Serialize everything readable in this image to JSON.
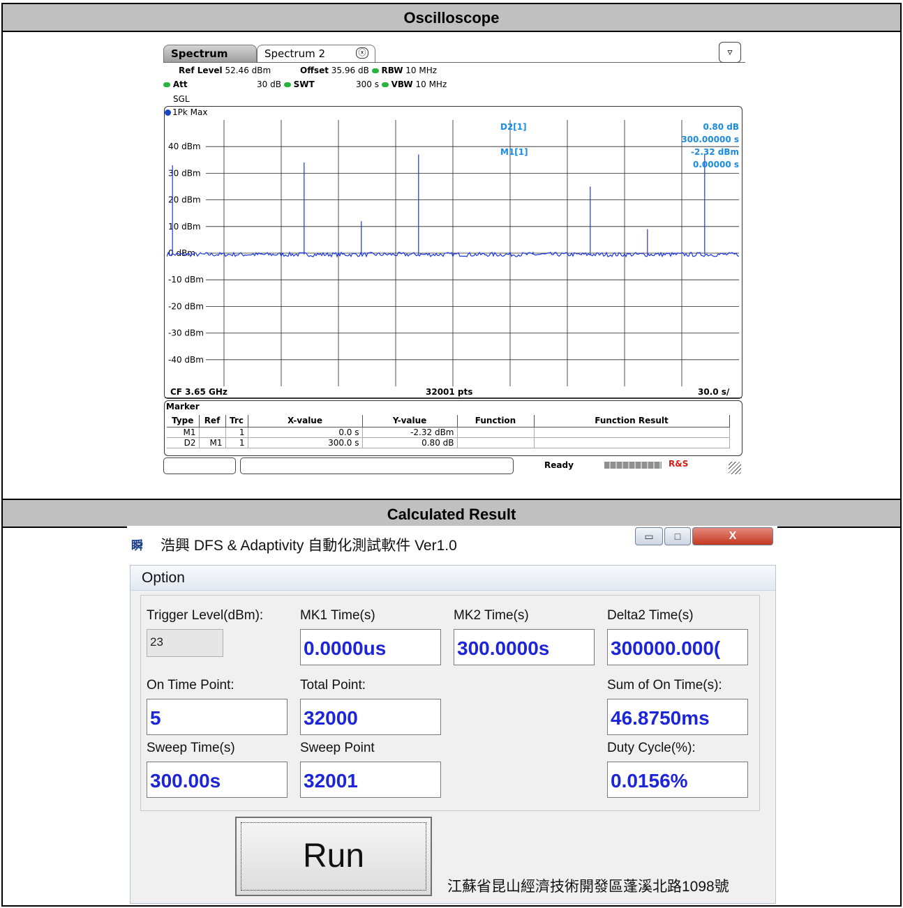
{
  "sections": {
    "top_header": "Oscilloscope",
    "bottom_header": "Calculated Result"
  },
  "analyzer": {
    "tabs": [
      {
        "label": "Spectrum"
      },
      {
        "label": "Spectrum 2"
      }
    ],
    "tab_close": "ⓧ",
    "params": {
      "ref_level_label": "Ref Level",
      "ref_level_value": "52.46 dBm",
      "offset_label": "Offset",
      "offset_value": "35.96 dB",
      "rbw_label": "RBW",
      "rbw_value": "10 MHz",
      "att_label": "Att",
      "att_value": "30 dB",
      "swt_label": "SWT",
      "swt_value": "300 s",
      "vbw_label": "VBW",
      "vbw_value": "10 MHz",
      "sgl": "SGL"
    },
    "trace_label": "1Pk Max",
    "y_ticks": [
      "40 dBm",
      "30 dBm",
      "20 dBm",
      "10 dBm",
      "0 dBm",
      "-10 dBm",
      "-20 dBm",
      "-30 dBm",
      "-40 dBm"
    ],
    "marker_labels": {
      "d2": "D2[1]",
      "m1": "M1[1]"
    },
    "marker_readout": [
      "0.80 dB",
      "300.00000 s",
      "-2.32 dBm",
      "0.00000 s"
    ],
    "footer": {
      "cf": "CF 3.65 GHz",
      "pts": "32001 pts",
      "scale": "30.0 s/"
    },
    "marker_table": {
      "title": "Marker",
      "headers": [
        "Type",
        "Ref",
        "Trc",
        "X-value",
        "Y-value",
        "Function",
        "Function Result"
      ],
      "rows": [
        [
          "M1",
          "",
          "1",
          "0.0 s",
          "-2.32 dBm",
          "",
          ""
        ],
        [
          "D2",
          "M1",
          "1",
          "300.0 s",
          "0.80 dB",
          "",
          ""
        ]
      ]
    },
    "status": {
      "ready": "Ready",
      "logo": "R&S"
    },
    "colors": {
      "trace": "#1b35e0",
      "marker_text": "#1a8ce0",
      "led": "#27b33e"
    }
  },
  "chart_data": {
    "type": "line",
    "title": "",
    "xlabel": "",
    "ylabel": "",
    "ylim": [
      -50,
      50
    ],
    "x_span_s": [
      0,
      300
    ],
    "noise_floor_dbm": -0.5,
    "pulses": [
      {
        "x": 3.0,
        "y": 33
      },
      {
        "x": 13,
        "y": 0.5
      },
      {
        "x": 72,
        "y": 34
      },
      {
        "x": 102,
        "y": 12
      },
      {
        "x": 132,
        "y": 37
      },
      {
        "x": 192,
        "y": 0.5
      },
      {
        "x": 222,
        "y": 25
      },
      {
        "x": 252,
        "y": 9
      },
      {
        "x": 282,
        "y": 37
      }
    ]
  },
  "software": {
    "window_title": "浩興 DFS & Adaptivity 自動化測試軟件 Ver1.0",
    "app_icon": "瞬",
    "controls": {
      "minimize": "▭",
      "maximize": "□",
      "close": "X"
    },
    "menu": {
      "option": "Option"
    },
    "fields": {
      "trigger_level": {
        "label": "Trigger Level(dBm):",
        "value": "23"
      },
      "mk1_time": {
        "label": "MK1 Time(s)",
        "value": "0.0000us"
      },
      "mk2_time": {
        "label": "MK2 Time(s)",
        "value": "300.0000s"
      },
      "delta2_time": {
        "label": "Delta2 Time(s)",
        "value": "300000.000("
      },
      "on_time_point": {
        "label": "On Time Point:",
        "value": "5"
      },
      "total_point": {
        "label": "Total Point:",
        "value": "32000"
      },
      "sum_on_time": {
        "label": "Sum of On Time(s):",
        "value": "46.8750ms"
      },
      "sweep_time": {
        "label": "Sweep Time(s)",
        "value": "300.00s"
      },
      "sweep_point": {
        "label": "Sweep Point",
        "value": "32001"
      },
      "duty_cycle": {
        "label": "Duty Cycle(%):",
        "value": "0.0156%"
      }
    },
    "run_button": "Run",
    "address": "江蘇省昆山經濟技術開發區蓬溪北路1098號",
    "colors": {
      "value_text": "#1d25d8"
    }
  }
}
